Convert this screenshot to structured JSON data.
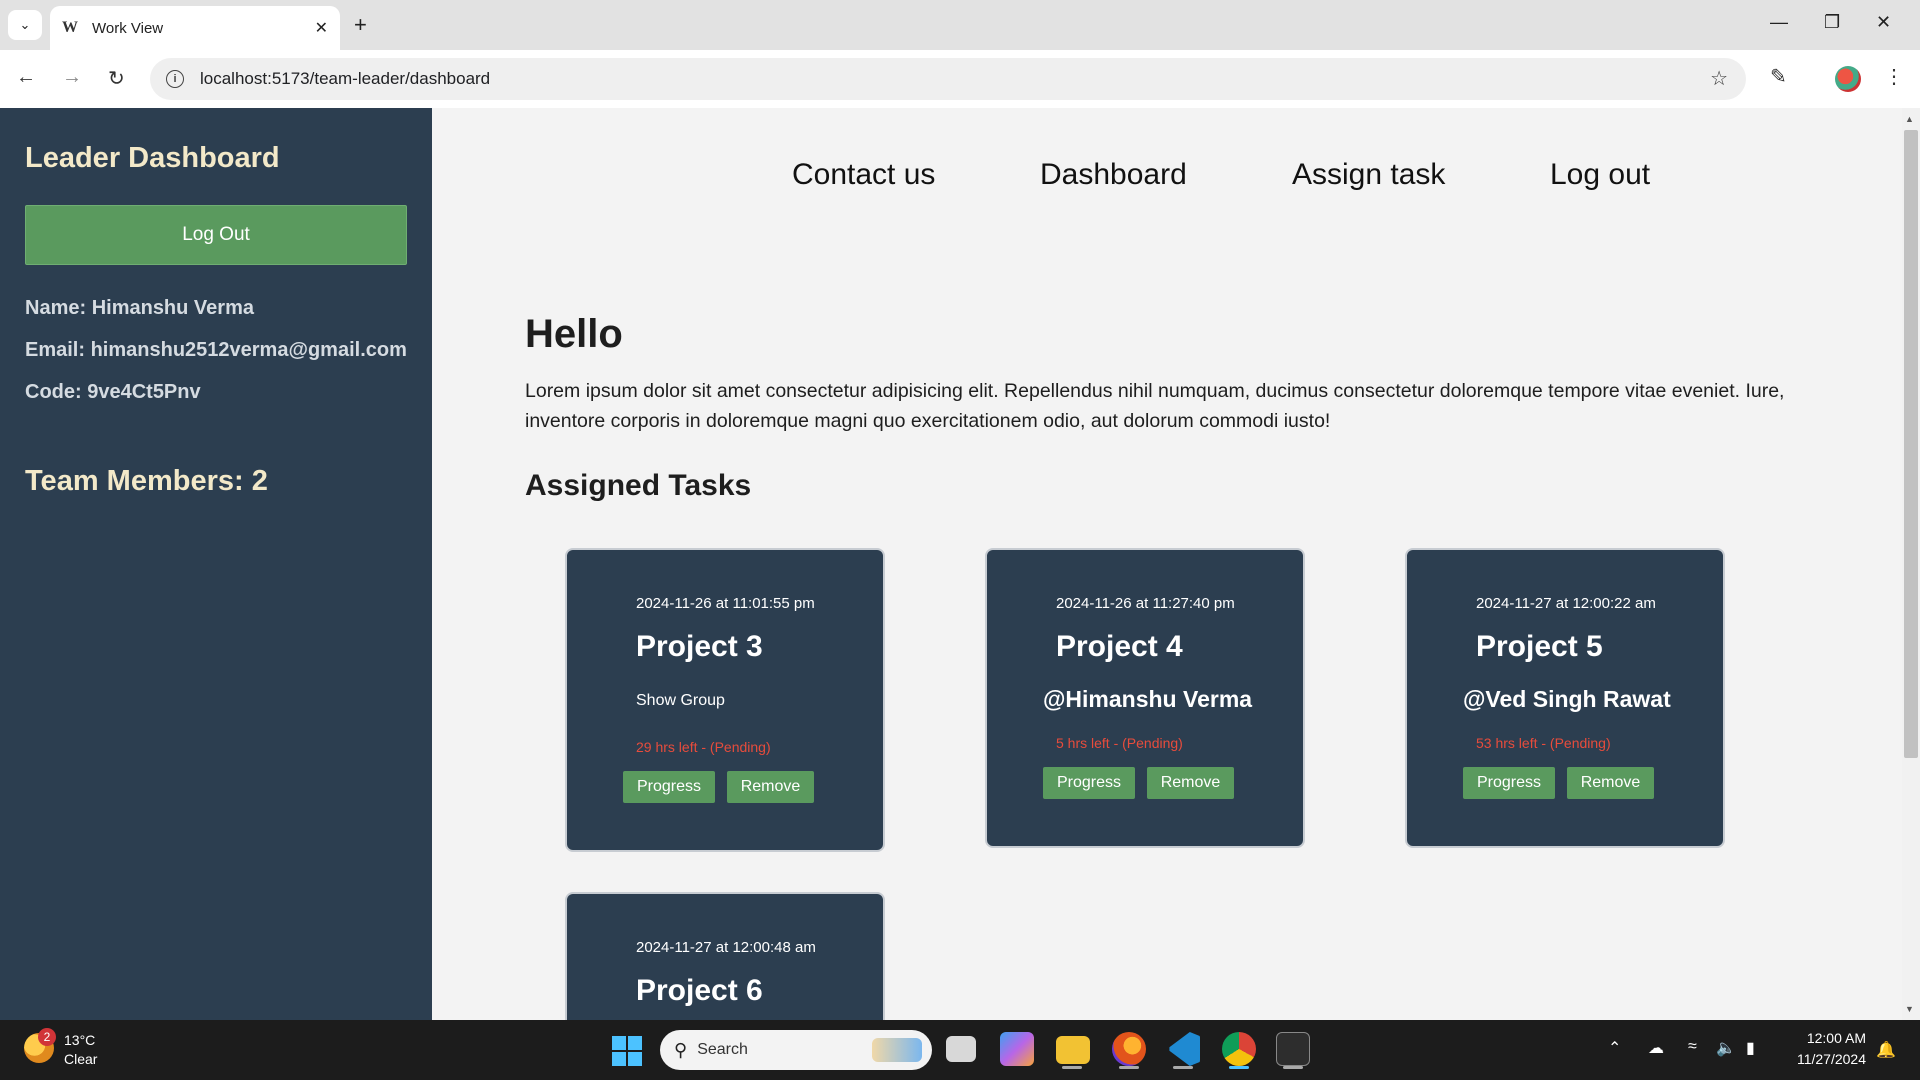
{
  "browser": {
    "tab_title": "Work View",
    "tab_favicon": "W",
    "url": "localhost:5173/team-leader/dashboard"
  },
  "sidebar": {
    "title": "Leader Dashboard",
    "logout_label": "Log Out",
    "name_line": "Name: Himanshu Verma",
    "email_line": "Email: himanshu2512verma@gmail.com",
    "code_line": "Code: 9ve4Ct5Pnv",
    "team_members": "Team Members: 2"
  },
  "nav": {
    "contact": "Contact us",
    "dashboard": "Dashboard",
    "assign": "Assign task",
    "logout": "Log out"
  },
  "main": {
    "greeting": "Hello",
    "intro": "Lorem ipsum dolor sit amet consectetur adipisicing elit. Repellendus nihil numquam, ducimus consectetur doloremque tempore vitae eveniet. Iure, inventore corporis in doloremque magni quo exercitationem odio, aut dolorum commodi iusto!",
    "tasks_heading": "Assigned Tasks",
    "progress_label": "Progress",
    "remove_label": "Remove"
  },
  "tasks": [
    {
      "date": "2024-11-26 at 11:01:55 pm",
      "project": "Project 3",
      "assignee": "Show Group",
      "status": "29 hrs left - (Pending)"
    },
    {
      "date": "2024-11-26 at 11:27:40 pm",
      "project": "Project 4",
      "assignee": "@Himanshu Verma",
      "status": "5 hrs left - (Pending)"
    },
    {
      "date": "2024-11-27 at 12:00:22 am",
      "project": "Project 5",
      "assignee": "@Ved Singh Rawat",
      "status": "53 hrs left - (Pending)"
    },
    {
      "date": "2024-11-27 at 12:00:48 am",
      "project": "Project 6"
    }
  ],
  "taskbar": {
    "weather_badge": "2",
    "temperature": "13°C",
    "weather": "Clear",
    "search_placeholder": "Search",
    "time": "12:00 AM",
    "date": "11/27/2024"
  },
  "colors": {
    "sidebar_bg": "#2c3e50",
    "accent_green": "#5a9a5e",
    "title_cream": "#f3e9c9",
    "pending_red": "#e74c3c"
  }
}
